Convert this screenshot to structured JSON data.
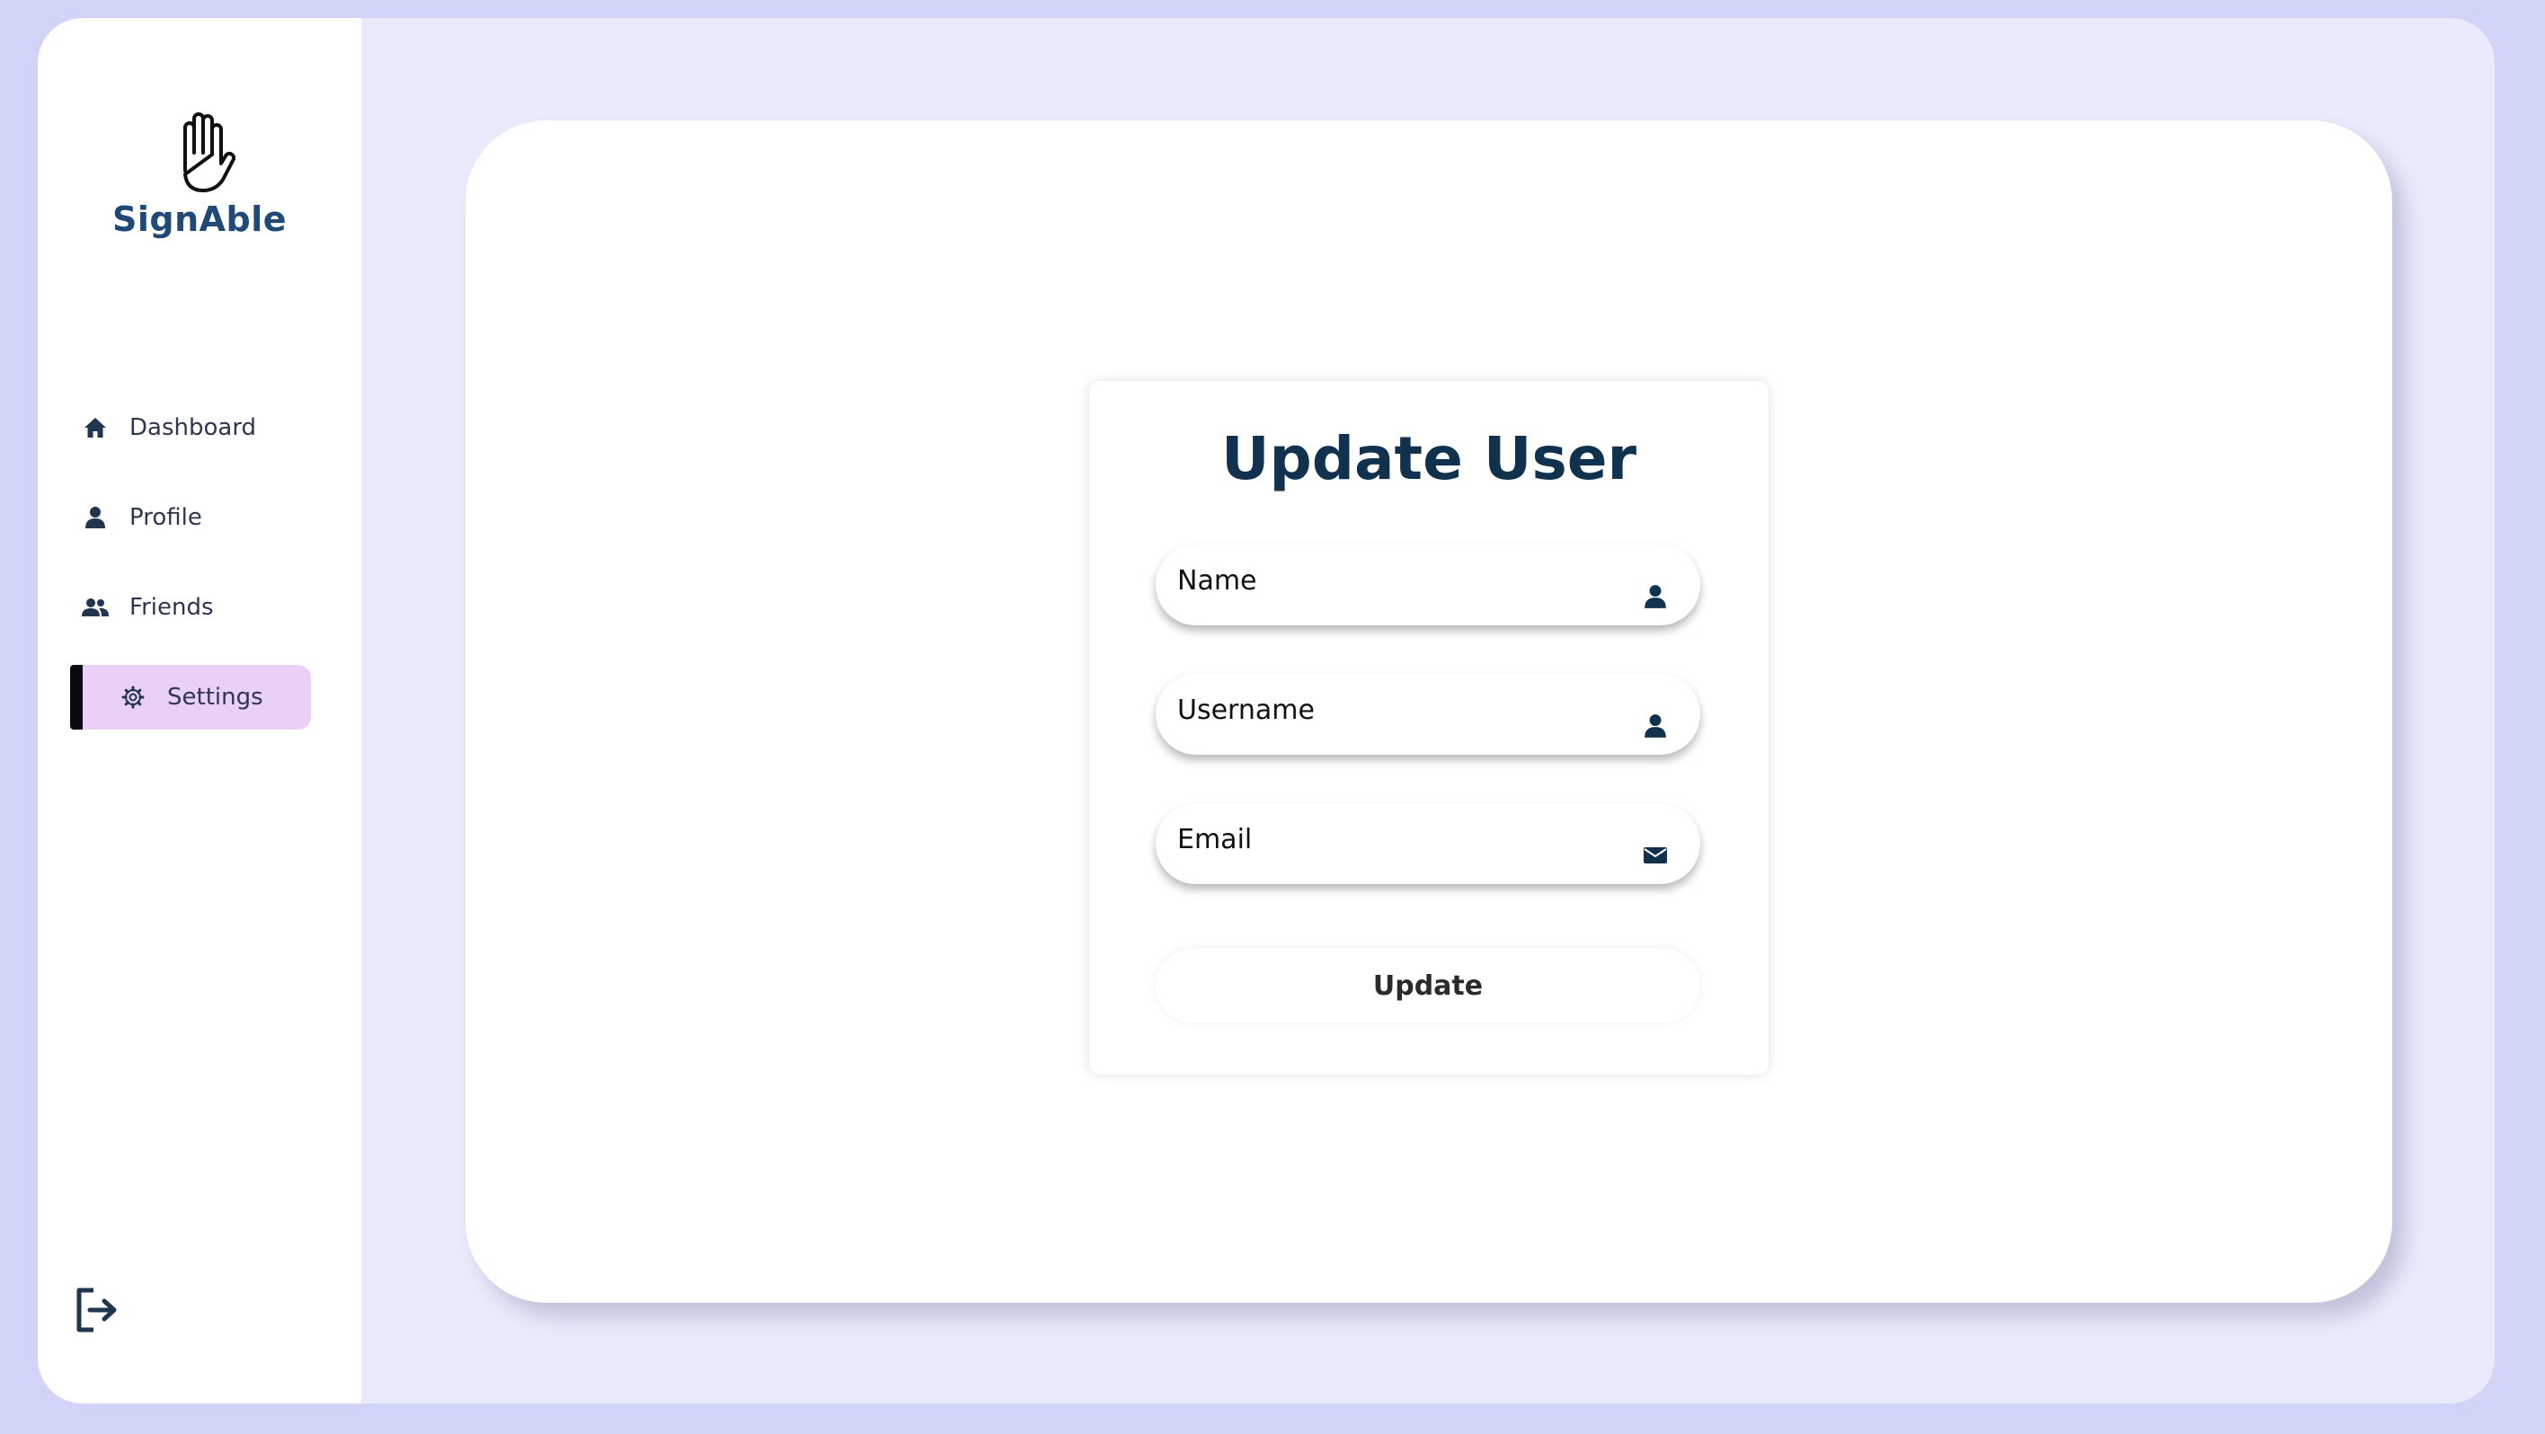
{
  "brand": {
    "name": "SignAble",
    "logo_icon": "raised-hand-icon",
    "color": "#1f4a77"
  },
  "sidebar": {
    "items": [
      {
        "label": "Dashboard",
        "icon": "home-icon",
        "active": false
      },
      {
        "label": "Profile",
        "icon": "user-icon",
        "active": false
      },
      {
        "label": "Friends",
        "icon": "users-icon",
        "active": false
      },
      {
        "label": "Settings",
        "icon": "gear-icon",
        "active": true
      }
    ],
    "active_color": "#ead0f7",
    "logout_icon": "logout-icon"
  },
  "form": {
    "title": "Update User",
    "fields": [
      {
        "placeholder": "Name",
        "value": "",
        "icon": "user-icon"
      },
      {
        "placeholder": "Username",
        "value": "",
        "icon": "user-icon"
      },
      {
        "placeholder": "Email",
        "value": "",
        "icon": "envelope-icon"
      }
    ],
    "submit_label": "Update"
  },
  "colors": {
    "page_background": "#d2d4f7",
    "frame_background": "#e9eafb",
    "title": "#10324f",
    "icon": "#10324f"
  }
}
